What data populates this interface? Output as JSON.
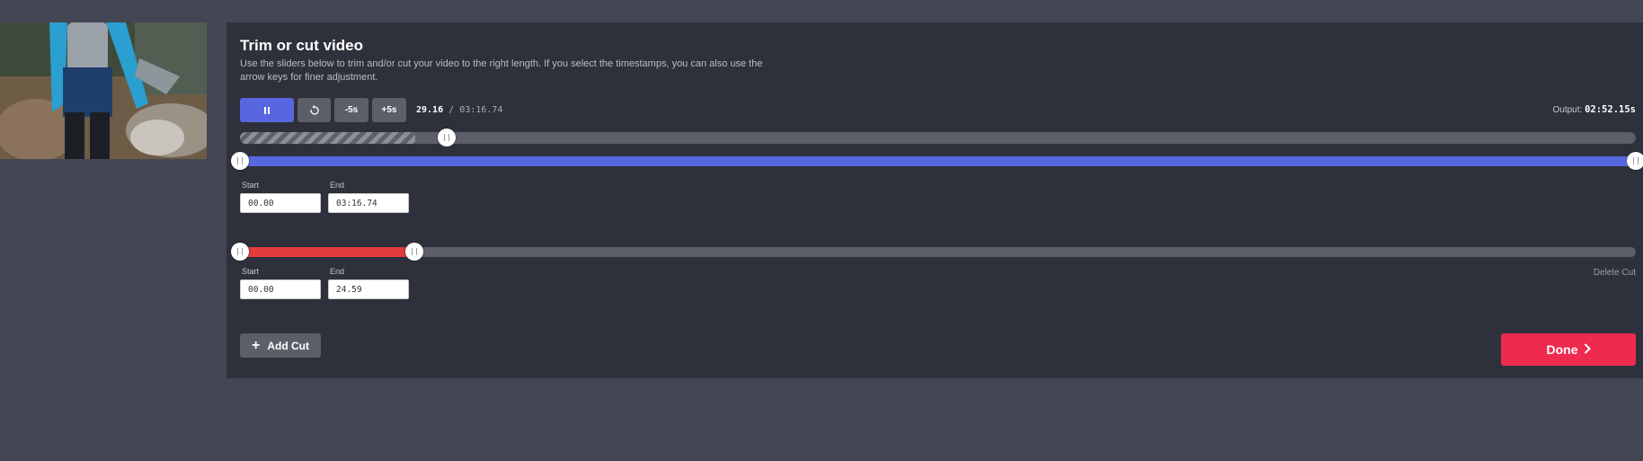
{
  "thumbnail": {
    "icon": "video-thumbnail"
  },
  "panel": {
    "title": "Trim or cut video",
    "description": "Use the sliders below to trim and/or cut your video to the right length. If you select the timestamps, you can also use the arrow keys for finer adjustment."
  },
  "playback": {
    "play_pause_icon": "pause-icon",
    "replay_icon": "replay-icon",
    "back_label": "-5s",
    "forward_label": "+5s",
    "current_time": "29.16",
    "separator": "/",
    "duration": "03:16.74",
    "progress_fraction": 0.148
  },
  "output": {
    "label": "Output:",
    "value": "02:52.15s"
  },
  "trim": {
    "color": "#5867e0",
    "start_label": "Start",
    "end_label": "End",
    "start_value": "00.00",
    "end_value": "03:16.74"
  },
  "cut": {
    "color": "#e03c3c",
    "start_label": "Start",
    "end_label": "End",
    "start_value": "00.00",
    "end_value": "24.59",
    "delete_label": "Delete Cut"
  },
  "add_cut": {
    "icon": "plus-icon",
    "label": "Add Cut"
  },
  "done": {
    "label": "Done",
    "icon": "chevron-right-icon",
    "color": "#ee2a4f"
  }
}
